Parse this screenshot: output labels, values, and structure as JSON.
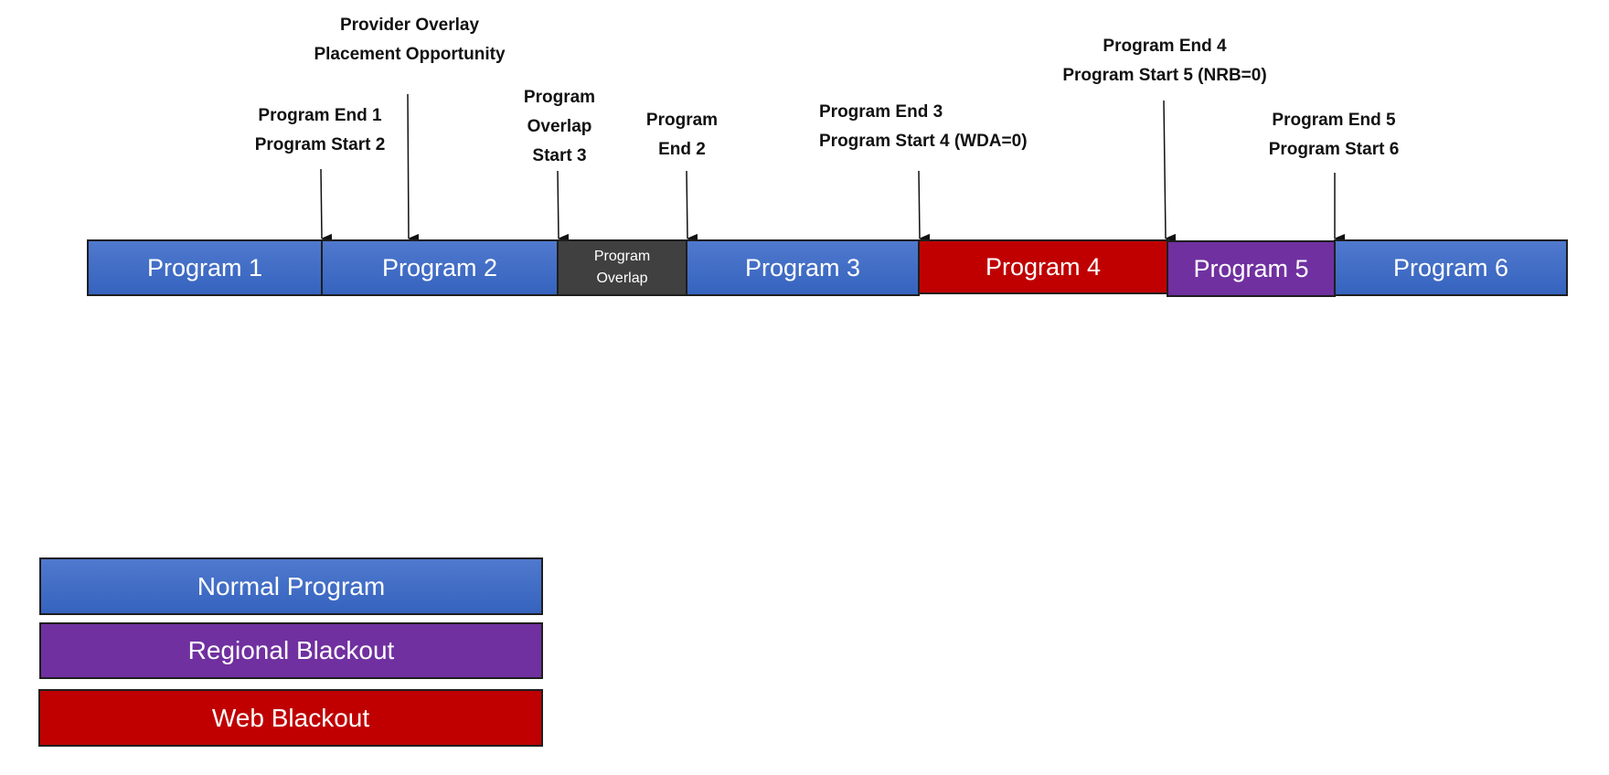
{
  "colors": {
    "normal": "#3f6cc6",
    "overlap": "#404040",
    "web_blackout": "#c00000",
    "regional_blackout": "#7030a0"
  },
  "segments": [
    {
      "label": "Program 1",
      "type": "normal"
    },
    {
      "label": "Program 2",
      "type": "normal"
    },
    {
      "label": "Program Overlap",
      "type": "overlap"
    },
    {
      "label": "Program 3",
      "type": "normal"
    },
    {
      "label": "Program 4",
      "type": "web_blackout"
    },
    {
      "label": "Program 5",
      "type": "regional_blackout"
    },
    {
      "label": "Program 6",
      "type": "normal"
    }
  ],
  "annotations": [
    {
      "lines": [
        "Program End 1",
        "Program Start 2"
      ]
    },
    {
      "lines": [
        "Provider Overlay",
        "Placement Opportunity"
      ]
    },
    {
      "lines": [
        "Program",
        "Overlap",
        "Start 3"
      ]
    },
    {
      "lines": [
        "Program",
        "End 2"
      ]
    },
    {
      "lines": [
        "Program End 3",
        "Program Start 4 (WDA=0)"
      ]
    },
    {
      "lines": [
        "Program End 4",
        "Program Start 5 (NRB=0)"
      ]
    },
    {
      "lines": [
        "Program End 5",
        "Program Start 6"
      ]
    }
  ],
  "legend": [
    {
      "label": "Normal Program",
      "type": "normal"
    },
    {
      "label": "Regional Blackout",
      "type": "regional_blackout"
    },
    {
      "label": "Web Blackout",
      "type": "web_blackout"
    }
  ]
}
